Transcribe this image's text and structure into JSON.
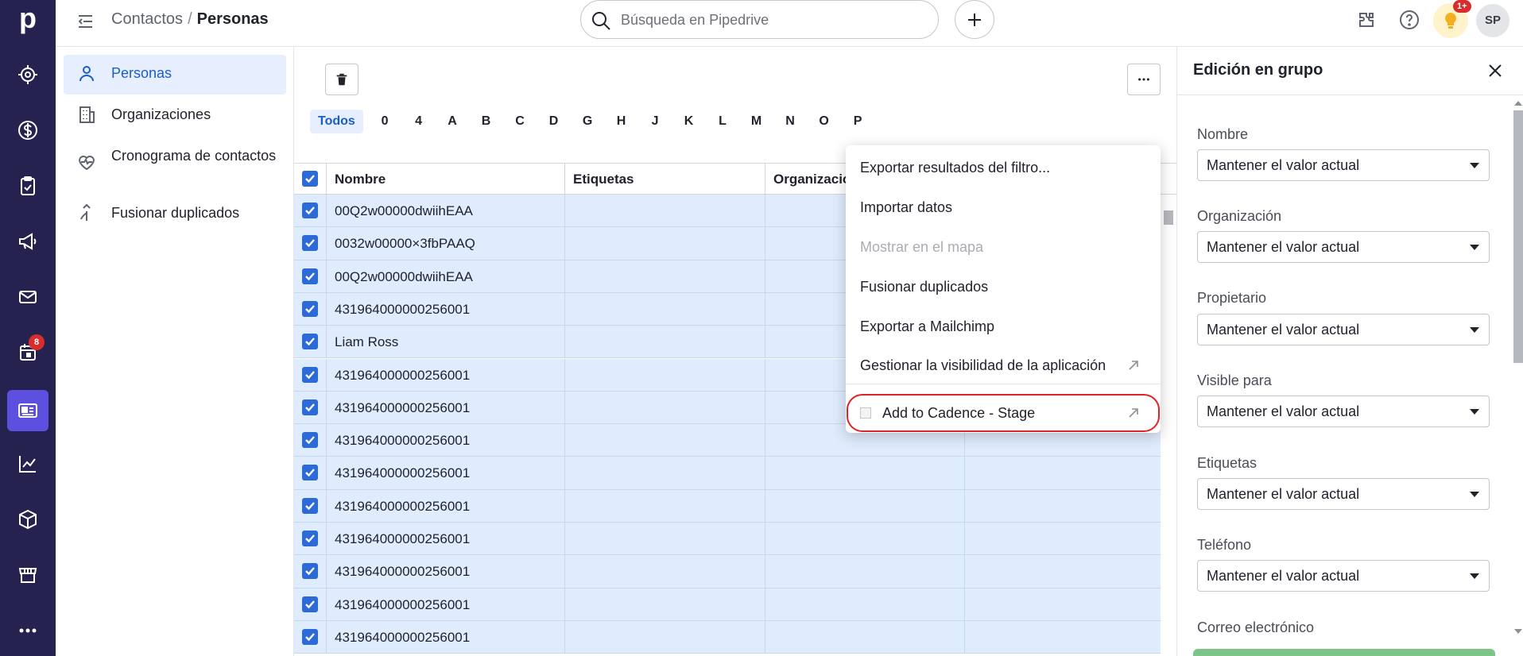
{
  "app": {
    "logo": "p"
  },
  "nav": {
    "items": [
      {
        "icon": "target-icon"
      },
      {
        "icon": "dollar-icon"
      },
      {
        "icon": "clipboard-check-icon"
      },
      {
        "icon": "megaphone-icon"
      },
      {
        "icon": "mail-icon"
      },
      {
        "icon": "calendar-icon",
        "badge": "8"
      },
      {
        "icon": "contacts-card-icon",
        "active": true
      },
      {
        "icon": "chart-icon"
      },
      {
        "icon": "box-icon"
      },
      {
        "icon": "store-icon"
      },
      {
        "icon": "more-dots-icon"
      }
    ]
  },
  "header": {
    "breadcrumb_parent": "Contactos",
    "breadcrumb_sep": "/",
    "breadcrumb_current": "Personas",
    "search_placeholder": "Búsqueda en Pipedrive",
    "tips_badge": "1+",
    "avatar_initials": "SP"
  },
  "subnav": {
    "items": [
      {
        "label": "Personas",
        "icon": "person-icon",
        "active": true
      },
      {
        "label": "Organizaciones",
        "icon": "building-icon"
      },
      {
        "label": "Cronograma de contactos",
        "icon": "heart-pulse-icon"
      },
      {
        "label": "Fusionar duplicados",
        "icon": "merge-icon"
      }
    ]
  },
  "alphabet": {
    "all": "Todos",
    "letters": [
      "0",
      "4",
      "A",
      "B",
      "C",
      "D",
      "G",
      "H",
      "J",
      "K",
      "L",
      "M",
      "N",
      "O",
      "P"
    ]
  },
  "table": {
    "columns": [
      "Nombre",
      "Etiquetas",
      "Organización"
    ],
    "rows": [
      "00Q2w00000dwiihEAA",
      "0032w00000×3fbPAAQ",
      "00Q2w00000dwiihEAA",
      "431964000000256001",
      "Liam Ross",
      "431964000000256001",
      "431964000000256001",
      "431964000000256001",
      "431964000000256001",
      "431964000000256001",
      "431964000000256001",
      "431964000000256001",
      "431964000000256001",
      "431964000000256001"
    ]
  },
  "dropdown": {
    "items": [
      {
        "label": "Exportar resultados del filtro...",
        "disabled": false
      },
      {
        "label": "Importar datos",
        "disabled": false
      },
      {
        "label": "Mostrar en el mapa",
        "disabled": true
      },
      {
        "label": "Fusionar duplicados",
        "disabled": false
      },
      {
        "label": "Exportar a Mailchimp",
        "disabled": false
      },
      {
        "label": "Gestionar la visibilidad de la aplicación",
        "disabled": false,
        "external": true
      }
    ],
    "app_item": {
      "label": "Add to Cadence - Stage",
      "external": true
    }
  },
  "bulk_edit": {
    "title": "Edición en grupo",
    "default_value": "Mantener el valor actual",
    "fields": [
      "Nombre",
      "Organización",
      "Propietario",
      "Visible para",
      "Etiquetas",
      "Teléfono"
    ],
    "next_field": "Correo electrónico"
  },
  "colors": {
    "nav_bg": "#26224f",
    "nav_active": "#5d4fe0",
    "accent": "#2c6ad7",
    "row_selected": "#dfecfd",
    "highlight": "#e02424"
  }
}
